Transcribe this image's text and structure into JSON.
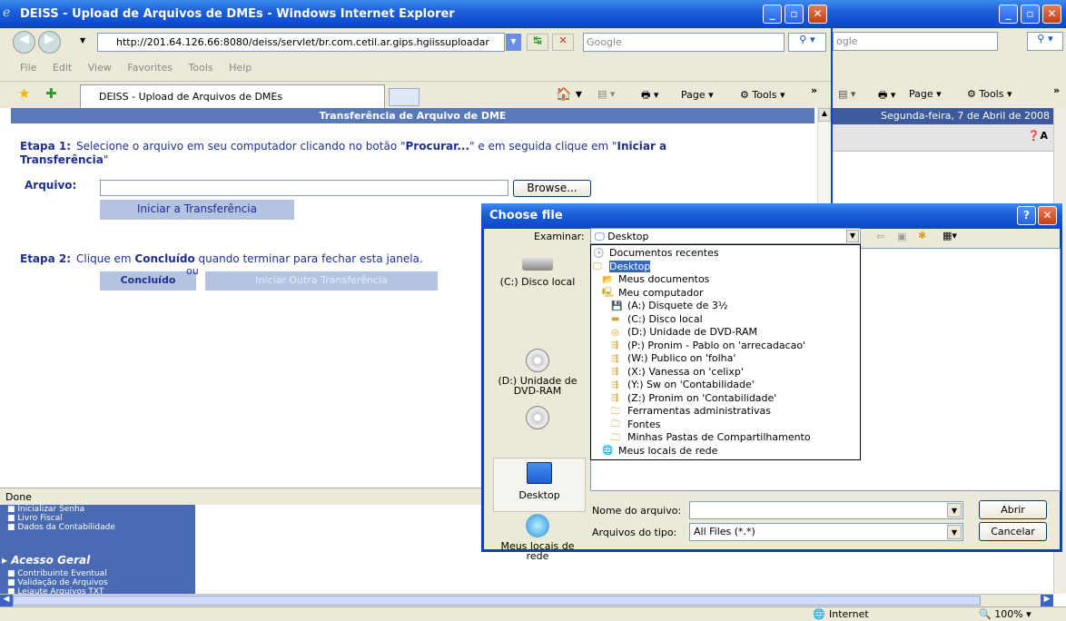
{
  "back_window": {
    "search_text": "ogle",
    "page_label": "Page",
    "tools_label": "Tools",
    "date": "Segunda-feira, 7 de Abril de 2008"
  },
  "ie": {
    "title": "DEISS - Upload de Arquivos de DMEs - Windows Internet Explorer",
    "url": "http://201.64.126.66:8080/deiss/servlet/br.com.cetil.ar.gips.hgiissuploadar",
    "search_placeholder": "Google",
    "menu": [
      "File",
      "Edit",
      "View",
      "Favorites",
      "Tools",
      "Help"
    ],
    "tab_label": "DEISS - Upload de Arquivos de DMEs",
    "page_label": "Page",
    "tools_label": "Tools",
    "status": "Done"
  },
  "page": {
    "header": "Transferência de Arquivo de DME",
    "step1_label": "Etapa 1:",
    "step1_a": "Selecione o arquivo em seu computador clicando no botão \"",
    "step1_b": "Procurar...",
    "step1_c": "\" e em seguida clique em \"",
    "step1_d": "Iniciar a Transferência",
    "step1_e": "\"",
    "file_label": "Arquivo:",
    "browse": "Browse...",
    "start_button": "Iniciar a Transferência",
    "step2_label": "Etapa 2:",
    "step2_a": "Clique em ",
    "step2_b": "Concluído",
    "step2_c": " quando terminar para fechar esta janela.",
    "done_button": "Concluído",
    "ou": "ou",
    "other_button": "Iniciar Outra Transferência"
  },
  "sidebar": {
    "items_top": [
      "Inicializar Senha",
      "Livro Fiscal",
      "Dados da Contabilidade"
    ],
    "section": "Acesso Geral",
    "items": [
      "Contribuinte Eventual",
      "Validação de Arquivos",
      "Leiaute Arquivos TXT"
    ]
  },
  "status_bar": {
    "zone": "Internet",
    "zoom": "100%"
  },
  "dialog": {
    "title": "Choose file",
    "look_in_label": "Examinar:",
    "look_in_value": "Desktop",
    "places": [
      "(C:) Disco local",
      "(D:) Unidade de DVD-RAM",
      "Desktop",
      "Meus locais de rede"
    ],
    "list": [
      {
        "text": "Documentos recentes",
        "indent": 0,
        "icon": "recent-icon",
        "selected": false
      },
      {
        "text": "Desktop",
        "indent": 0,
        "icon": "desktop-icon",
        "selected": true
      },
      {
        "text": "Meus documentos",
        "indent": 1,
        "icon": "folder-icon",
        "selected": false
      },
      {
        "text": "Meu computador",
        "indent": 1,
        "icon": "computer-icon",
        "selected": false
      },
      {
        "text": "(A:) Disquete de 3½",
        "indent": 2,
        "icon": "floppy-icon",
        "selected": false
      },
      {
        "text": "(C:) Disco local",
        "indent": 2,
        "icon": "drive-icon",
        "selected": false
      },
      {
        "text": "(D:) Unidade de DVD-RAM",
        "indent": 2,
        "icon": "cd-icon",
        "selected": false
      },
      {
        "text": "(P:) Pronim - Pablo on 'arrecadacao'",
        "indent": 2,
        "icon": "network-drive-icon",
        "selected": false
      },
      {
        "text": "(W:) Publico on 'folha'",
        "indent": 2,
        "icon": "network-drive-icon",
        "selected": false
      },
      {
        "text": "(X:) Vanessa on 'celixp'",
        "indent": 2,
        "icon": "network-drive-icon",
        "selected": false
      },
      {
        "text": "(Y:) Sw on 'Contabilidade'",
        "indent": 2,
        "icon": "network-drive-icon",
        "selected": false
      },
      {
        "text": "(Z:) Pronim on 'Contabilidade'",
        "indent": 2,
        "icon": "network-drive-icon",
        "selected": false
      },
      {
        "text": "Ferramentas administrativas",
        "indent": 2,
        "icon": "tools-folder-icon",
        "selected": false
      },
      {
        "text": "Fontes",
        "indent": 2,
        "icon": "fonts-folder-icon",
        "selected": false
      },
      {
        "text": "Minhas Pastas de Compartilhamento",
        "indent": 2,
        "icon": "shared-folder-icon",
        "selected": false
      },
      {
        "text": "Meus locais de rede",
        "indent": 1,
        "icon": "network-icon",
        "selected": false
      }
    ],
    "filename_label": "Nome do arquivo:",
    "filename_value": "",
    "filetype_label": "Arquivos do tipo:",
    "filetype_value": "All Files (*.*)",
    "open_button": "Abrir",
    "cancel_button": "Cancelar"
  }
}
